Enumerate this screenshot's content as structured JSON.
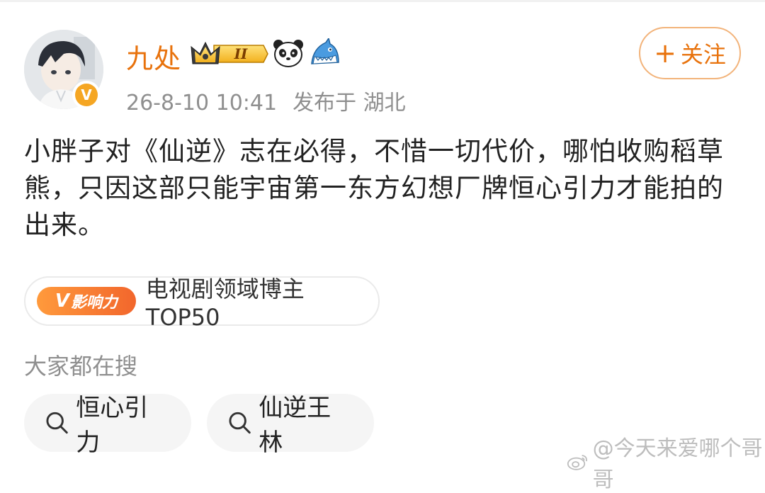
{
  "post": {
    "username": "九处",
    "level_badge": "II",
    "timestamp": "26-8-10 10:41",
    "publish_location": "发布于 湖北",
    "follow_label": "关注",
    "content": "小胖子对《仙逆》志在必得，不惜一切代价，哪怕收购稻草熊，只因这部只能宇宙第一东方幻想厂牌恒心引力才能拍的出来。"
  },
  "influence": {
    "badge_text": "影响力",
    "badge_letter": "V",
    "label": "电视剧领域博主TOP50"
  },
  "search": {
    "title": "大家都在搜",
    "items": [
      "恒心引力",
      "仙逆王林"
    ]
  },
  "watermark": {
    "text": "@今天来爱哪个哥哥"
  },
  "colors": {
    "accent": "#e8720c",
    "follow_border": "#f2b37a",
    "meta_gray": "#8f8f8f",
    "chip_bg": "#f5f5f5"
  },
  "icons": {
    "verified": "verified-icon",
    "crown": "crown-icon",
    "panda": "panda-icon",
    "shark": "shark-icon",
    "search": "search-icon",
    "weibo": "weibo-icon"
  }
}
